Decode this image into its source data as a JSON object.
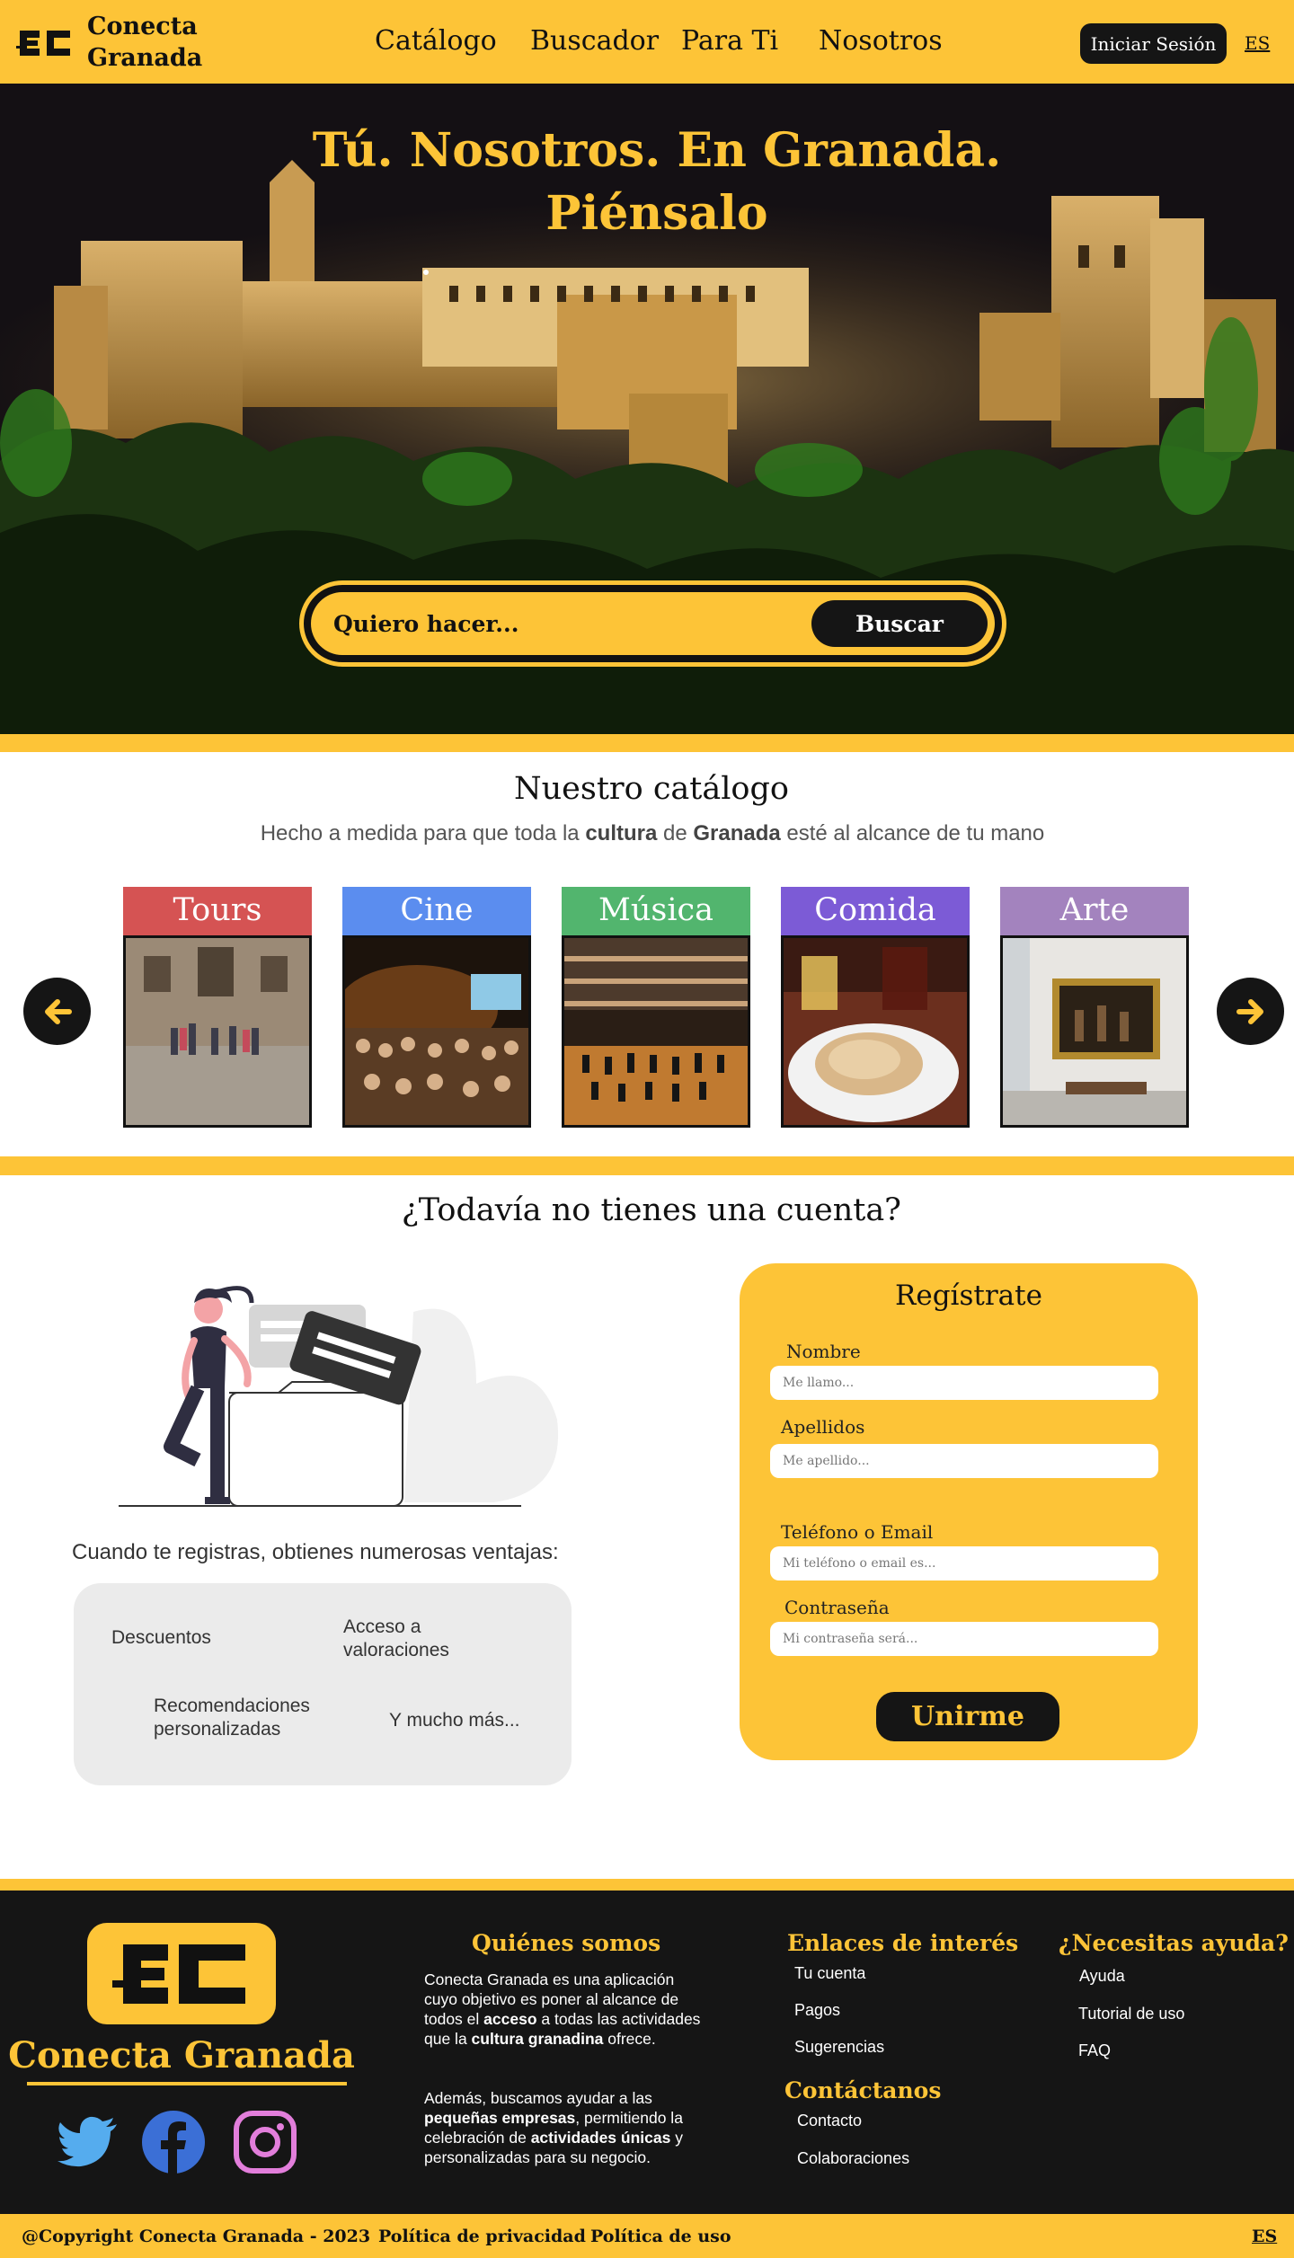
{
  "colors": {
    "brand_yellow": "#FDC437",
    "dark": "#151515",
    "tours": "#D55353",
    "cine": "#5B8DEF",
    "musica": "#52B56E",
    "comida": "#7C5BD6",
    "arte": "#A383BE"
  },
  "header": {
    "brand_line1": "Conecta",
    "brand_line2": "Granada",
    "nav": [
      "Catálogo",
      "Buscador",
      "Para Ti",
      "Nosotros"
    ],
    "login_label": "Iniciar Sesión",
    "lang": "ES"
  },
  "hero": {
    "title_line1": "Tú. Nosotros. En Granada.",
    "title_line2": "Piénsalo",
    "search_placeholder": "Quiero hacer...",
    "search_button": "Buscar"
  },
  "catalog": {
    "title": "Nuestro catálogo",
    "subtitle_pre": "Hecho a medida para que toda la ",
    "subtitle_b1": "cultura",
    "subtitle_mid": " de ",
    "subtitle_b2": "Granada",
    "subtitle_post": " esté al alcance de tu mano",
    "items": [
      {
        "label": "Tours",
        "color": "#D55353"
      },
      {
        "label": "Cine",
        "color": "#5B8DEF"
      },
      {
        "label": "Música",
        "color": "#52B56E"
      },
      {
        "label": "Comida",
        "color": "#7C5BD6"
      },
      {
        "label": "Arte",
        "color": "#A383BE"
      }
    ],
    "prev_icon": "arrow-left-icon",
    "next_icon": "arrow-right-icon"
  },
  "account": {
    "title": "¿Todavía no tienes una cuenta?",
    "benefits_intro": "Cuando te registras, obtienes numerosas ventajas:",
    "benefits": [
      "Descuentos",
      "Acceso a valoraciones",
      "Recomendaciones personalizadas",
      "Y mucho más..."
    ]
  },
  "register": {
    "title": "Regístrate",
    "fields": [
      {
        "label": "Nombre",
        "placeholder": "Me llamo..."
      },
      {
        "label": "Apellidos",
        "placeholder": "Me apellido..."
      },
      {
        "label": "Teléfono o Email",
        "placeholder": "Mi teléfono o email es..."
      },
      {
        "label": "Contraseña",
        "placeholder": "Mi contraseña será..."
      }
    ],
    "submit": "Unirme"
  },
  "footer": {
    "brand": "Conecta Granada",
    "about_title": "Quiénes somos",
    "about_p1_a": "Conecta Granada es una aplicación cuyo objetivo es poner al alcance de todos el ",
    "about_p1_b": "acceso",
    "about_p1_c": " a todas las actividades que la ",
    "about_p1_d": "cultura granadina",
    "about_p1_e": " ofrece.",
    "about_p2_a": "Además, buscamos ayudar a las ",
    "about_p2_b": "pequeñas empresas",
    "about_p2_c": ", permitiendo la celebración de ",
    "about_p2_d": "actividades únicas",
    "about_p2_e": " y personalizadas para su negocio.",
    "links_title": "Enlaces de interés",
    "links": [
      "Tu cuenta",
      "Pagos",
      "Sugerencias"
    ],
    "contact_title": "Contáctanos",
    "contact_links": [
      "Contacto",
      "Colaboraciones"
    ],
    "help_title": "¿Necesitas ayuda?",
    "help_links": [
      "Ayuda",
      "Tutorial de uso",
      "FAQ"
    ],
    "social": [
      "twitter-icon",
      "facebook-icon",
      "instagram-icon"
    ]
  },
  "bottom": {
    "copyright": "@Copyright Conecta Granada - 2023",
    "privacy": "Política de privacidad",
    "terms": "Política de uso",
    "lang": "ES"
  }
}
